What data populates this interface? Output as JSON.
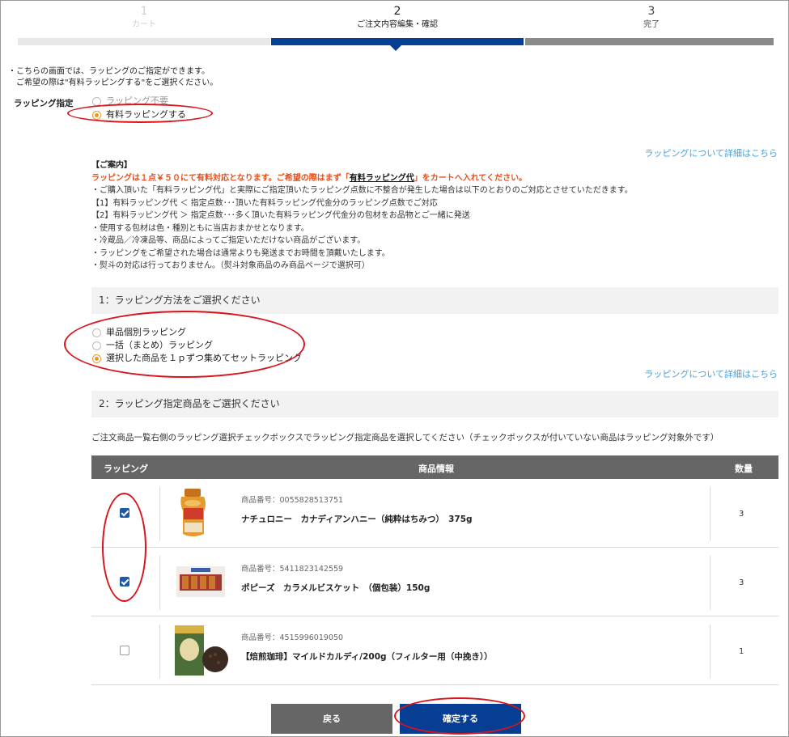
{
  "steps": [
    {
      "num": "1",
      "label": "カート"
    },
    {
      "num": "2",
      "label": "ご注文内容編集・確認"
    },
    {
      "num": "3",
      "label": "完了"
    }
  ],
  "intro": {
    "line1": "・こちらの画面では、ラッピングのご指定ができます。",
    "line2": "ご希望の際は\"有料ラッピングする\"をご選択ください。"
  },
  "wrapping": {
    "label": "ラッピング指定",
    "options": [
      "ラッピング不要",
      "有料ラッピングする"
    ],
    "selected_index": 1
  },
  "detail_link": "ラッピングについて詳細はこちら",
  "guide": {
    "head": "【ご案内】",
    "warn_pre": "ラッピングは１点￥５０にて有料対応となります。ご希望の際はまず「",
    "warn_link": "有料ラッピング代",
    "warn_post": "」をカートへ入れてください。",
    "lines": [
      "・ご購入頂いた「有料ラッピング代」と実際にご指定頂いたラッピング点数に不整合が発生した場合は以下のとおりのご対応とさせていただきます。",
      "【1】有料ラッピング代 ＜ 指定点数･･･頂いた有料ラッピング代金分のラッピング点数でご対応",
      "【2】有料ラッピング代 ＞ 指定点数･･･多く頂いた有料ラッピング代金分の包材をお品物とご一緒に発送",
      "・使用する包材は色・種別ともに当店おまかせとなります。",
      "・冷蔵品／冷凍品等、商品によってご指定いただけない商品がございます。",
      "・ラッピングをご希望された場合は通常よりも発送までお時間を頂戴いたします。",
      "・熨斗の対応は行っておりません。（熨斗対象商品のみ商品ページで選択可）"
    ]
  },
  "section1": {
    "title": "1：ラッピング方法をご選択ください",
    "options": [
      "単品個別ラッピング",
      "一括（まとめ）ラッピング",
      "選択した商品を１ｐずつ集めてセットラッピング"
    ],
    "selected_index": 2
  },
  "section2": {
    "title": "2：ラッピング指定商品をご選択ください",
    "note": "ご注文商品一覧右側のラッピング選択チェックボックスでラッピング指定商品を選択してください（チェックボックスが付いていない商品はラッピング対象外です）"
  },
  "table": {
    "headers": [
      "ラッピング",
      "商品情報",
      "数量"
    ],
    "rows": [
      {
        "checked": true,
        "code": "商品番号：0055828513751",
        "name": "ナチュロニー　カナディアンハニー（純粋はちみつ）　375g",
        "qty": "3"
      },
      {
        "checked": true,
        "code": "商品番号：5411823142559",
        "name": "ポピーズ　カラメルビスケット　（個包装）150g",
        "qty": "3"
      },
      {
        "checked": false,
        "code": "商品番号：4515996019050",
        "name": "【焙煎珈琲】マイルドカルディ/200g（フィルター用（中挽き））",
        "qty": "1"
      }
    ]
  },
  "buttons": {
    "back": "戻る",
    "confirm": "確定する"
  },
  "colors": {
    "accent": "#063e94",
    "warning": "#e2501e",
    "link": "#4aa0d8",
    "annotation": "#d9141b"
  }
}
